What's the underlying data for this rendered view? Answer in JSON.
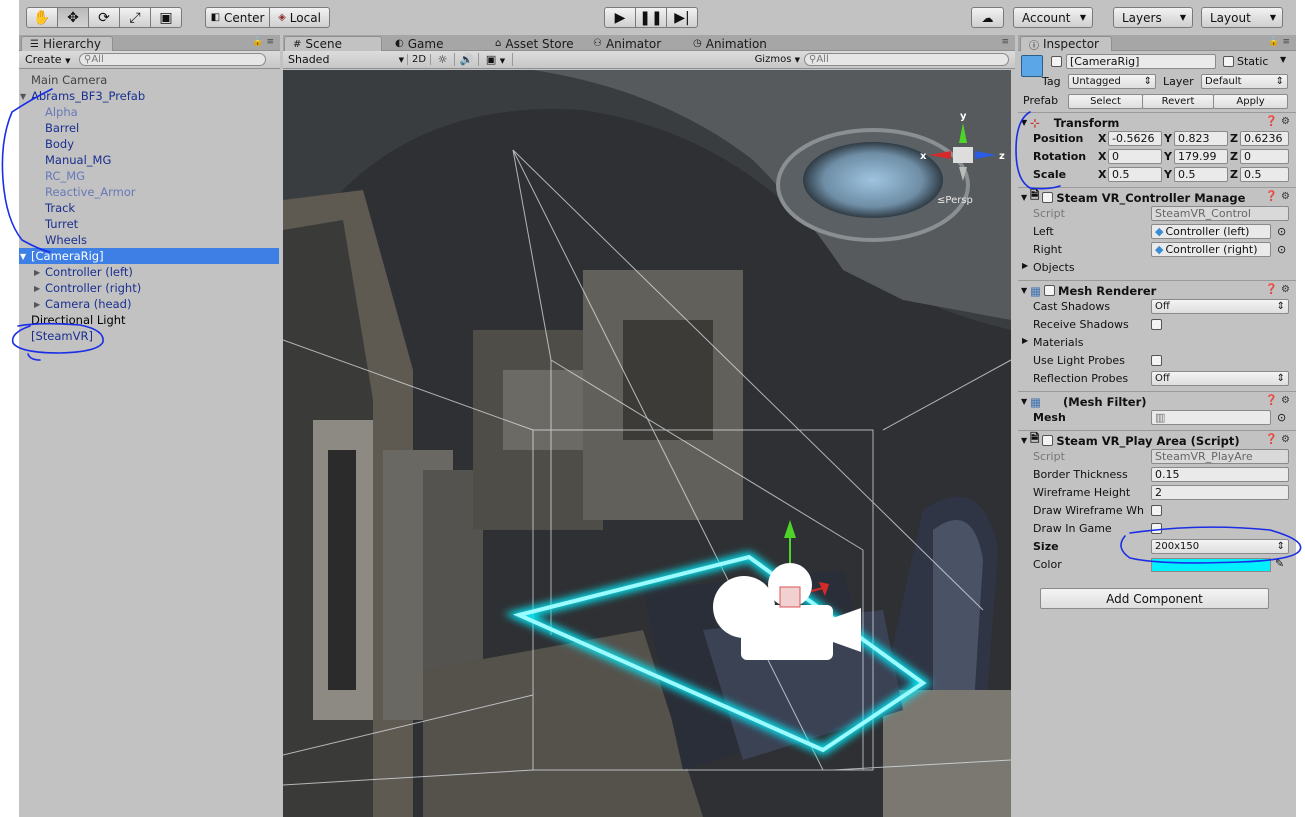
{
  "toolbar": {
    "tools": [
      "hand-tool",
      "move-tool",
      "rotate-tool",
      "scale-tool",
      "rect-tool"
    ],
    "pivot_mode": "Center",
    "pivot_rotation": "Local",
    "account": "Account",
    "layers": "Layers",
    "layout": "Layout"
  },
  "hierarchy": {
    "tab": "Hierarchy",
    "create": "Create",
    "search_placeholder": "All",
    "items": [
      {
        "label": "Main Camera",
        "indent": 0,
        "color": "gray"
      },
      {
        "label": "Abrams_BF3_Prefab",
        "indent": 0,
        "color": "blue",
        "expanded": true
      },
      {
        "label": "Alpha",
        "indent": 1,
        "color": "lightblue"
      },
      {
        "label": "Barrel",
        "indent": 1,
        "color": "blue"
      },
      {
        "label": "Body",
        "indent": 1,
        "color": "blue"
      },
      {
        "label": "Manual_MG",
        "indent": 1,
        "color": "blue"
      },
      {
        "label": "RC_MG",
        "indent": 1,
        "color": "lightblue"
      },
      {
        "label": "Reactive_Armor",
        "indent": 1,
        "color": "lightblue"
      },
      {
        "label": "Track",
        "indent": 1,
        "color": "blue"
      },
      {
        "label": "Turret",
        "indent": 1,
        "color": "blue"
      },
      {
        "label": "Wheels",
        "indent": 1,
        "color": "blue"
      },
      {
        "label": "[CameraRig]",
        "indent": 0,
        "color": "selected",
        "expanded": true
      },
      {
        "label": "Controller (left)",
        "indent": 1,
        "color": "blue",
        "collapsed": true
      },
      {
        "label": "Controller (right)",
        "indent": 1,
        "color": "blue",
        "collapsed": true
      },
      {
        "label": "Camera (head)",
        "indent": 1,
        "color": "blue",
        "collapsed": true
      },
      {
        "label": "Directional Light",
        "indent": 0,
        "color": "black"
      },
      {
        "label": "[SteamVR]",
        "indent": 0,
        "color": "blue"
      }
    ]
  },
  "scene": {
    "tabs": [
      {
        "label": "Scene",
        "icon": "#"
      },
      {
        "label": "Game",
        "icon": "◐"
      },
      {
        "label": "Asset Store",
        "icon": "⌂"
      },
      {
        "label": "Animator",
        "icon": "⚇"
      },
      {
        "label": "Animation",
        "icon": "◷"
      }
    ],
    "shading": "Shaded",
    "mode_2d": "2D",
    "gizmos": "Gizmos",
    "search_placeholder": "All",
    "projection": "Persp",
    "axes": {
      "y": "y",
      "x": "x",
      "z": "z"
    }
  },
  "inspector": {
    "tab": "Inspector",
    "object_name": "[CameraRig]",
    "static_label": "Static",
    "tag_label": "Tag",
    "tag_value": "Untagged",
    "layer_label": "Layer",
    "layer_value": "Default",
    "prefab_label": "Prefab",
    "prefab_buttons": [
      "Select",
      "Revert",
      "Apply"
    ],
    "transform": {
      "title": "Transform",
      "rows": [
        {
          "label": "Position",
          "x": "-0.5626",
          "y": "0.823",
          "z": "0.6236"
        },
        {
          "label": "Rotation",
          "x": "0",
          "y": "179.99",
          "z": "0"
        },
        {
          "label": "Scale",
          "x": "0.5",
          "y": "0.5",
          "z": "0.5"
        }
      ],
      "axis_labels": [
        "X",
        "Y",
        "Z"
      ]
    },
    "controller_manager": {
      "title": "Steam VR_Controller Manage",
      "script_label": "Script",
      "script_value": "SteamVR_Control",
      "left_label": "Left",
      "left_value": "Controller (left)",
      "right_label": "Right",
      "right_value": "Controller (right)",
      "objects_label": "Objects"
    },
    "mesh_renderer": {
      "title": "Mesh Renderer",
      "cast_shadows_label": "Cast Shadows",
      "cast_shadows_value": "Off",
      "receive_shadows_label": "Receive Shadows",
      "materials_label": "Materials",
      "light_probes_label": "Use Light Probes",
      "reflection_probes_label": "Reflection Probes",
      "reflection_probes_value": "Off"
    },
    "mesh_filter": {
      "title": "(Mesh Filter)",
      "mesh_label": "Mesh"
    },
    "play_area": {
      "title": "Steam VR_Play Area (Script)",
      "script_label": "Script",
      "script_value": "SteamVR_PlayAre",
      "border_label": "Border Thickness",
      "border_value": "0.15",
      "wire_height_label": "Wireframe Height",
      "wire_height_value": "2",
      "draw_wire_label": "Draw Wireframe Wh",
      "draw_game_label": "Draw In Game",
      "size_label": "Size",
      "size_value": "200x150",
      "color_label": "Color",
      "color_value": "#00f0ff"
    },
    "add_component": "Add Component"
  },
  "colors": {
    "selection": "#3e7fe6",
    "prefab_blue": "#1a2f8f",
    "annotation_ink": "#1a2ee6",
    "play_area_cyan": "#00f0ff"
  }
}
